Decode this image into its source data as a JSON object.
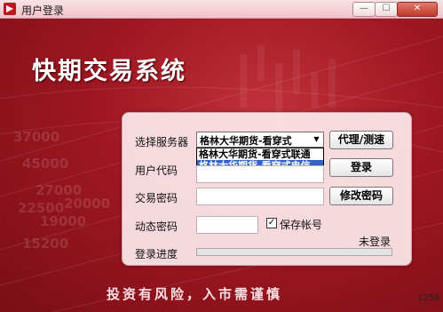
{
  "window": {
    "title": "用户登录",
    "min_glyph": "—",
    "max_glyph": "☐",
    "close_glyph": "✕"
  },
  "app_title": "快期交易系统",
  "background_numbers": [
    "37000",
    "45000",
    "27000",
    "22500",
    "19000",
    "15200",
    "20000"
  ],
  "form": {
    "server_label": "选择服务器",
    "server_selected": "格林大华期货-看穿式",
    "server_options": [
      "格林大华期货-看穿式联通",
      "格林大华期货-看穿式电信"
    ],
    "proxy_button": "代理/测速",
    "user_label": "用户代码",
    "user_value": "",
    "login_button": "登录",
    "password_label": "交易密码",
    "password_value": "",
    "change_password_button": "修改密码",
    "dynamic_label": "动态密码",
    "dynamic_value": "",
    "save_account_label": "保存帐号",
    "save_account_checked": true,
    "progress_label": "登录进度",
    "progress_value": 0,
    "status_text": "未登录"
  },
  "warning": "投资有风险，入市需谨慎",
  "version": "1256"
}
